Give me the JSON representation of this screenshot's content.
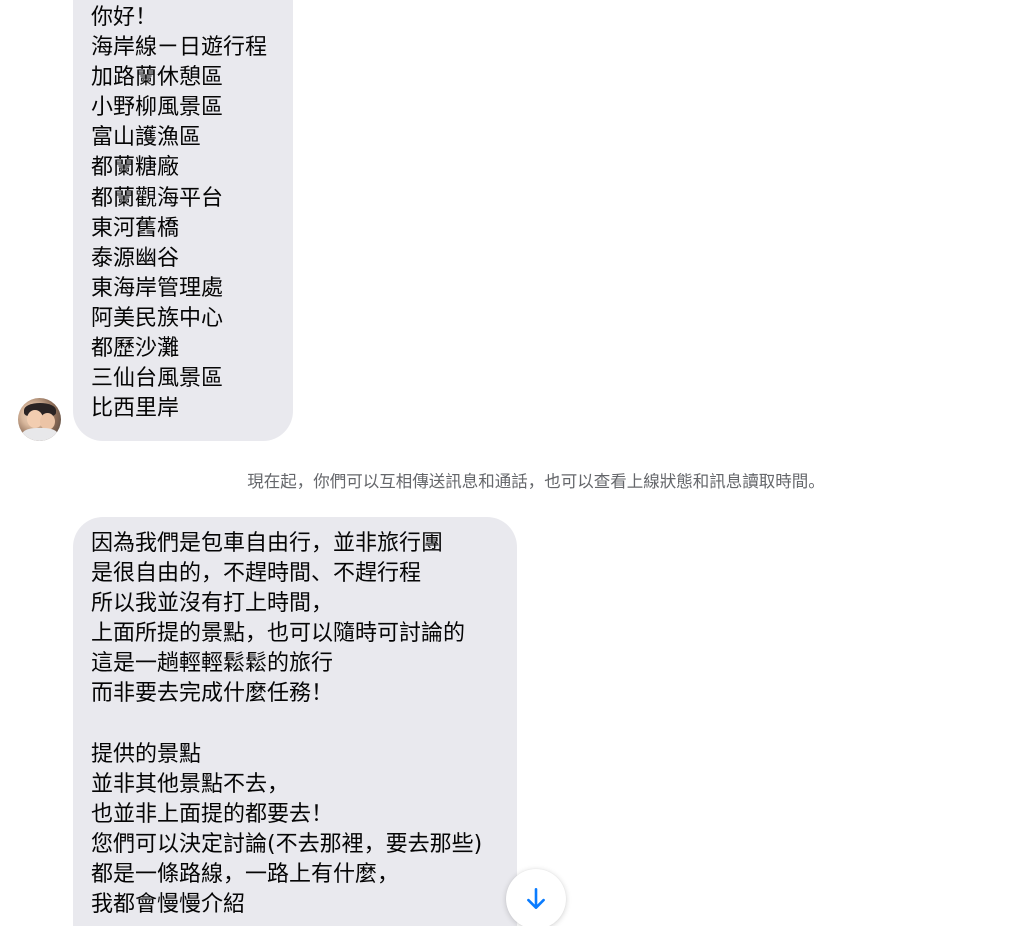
{
  "messages": [
    {
      "lines": [
        "你好！",
        "海岸線ㄧ日遊行程",
        "加路蘭休憩區",
        "小野柳風景區",
        "富山護漁區",
        "都蘭糖廠",
        "都蘭觀海平台",
        "東河舊橋",
        "泰源幽谷",
        "東海岸管理處",
        "阿美民族中心",
        "都歷沙灘",
        "三仙台風景區",
        "比西里岸"
      ]
    },
    {
      "lines": [
        "因為我們是包車自由行，並非旅行團",
        "是很自由的，不趕時間、不趕行程",
        "所以我並沒有打上時間，",
        "上面所提的景點，也可以隨時可討論的",
        "這是一趟輕輕鬆鬆的旅行",
        "而非要去完成什麼任務！",
        "",
        "提供的景點",
        "並非其他景點不去，",
        "也並非上面提的都要去！",
        "您們可以決定討論(不去那裡，要去那些)",
        "都是一條路線，一路上有什麼，",
        "我都會慢慢介紹"
      ]
    }
  ],
  "system_notice": "現在起，你們可以互相傳送訊息和通話，也可以查看上線狀態和訊息讀取時間。",
  "icons": {
    "scroll_down": "arrow-down-icon",
    "accent_color": "#0a7cff"
  }
}
